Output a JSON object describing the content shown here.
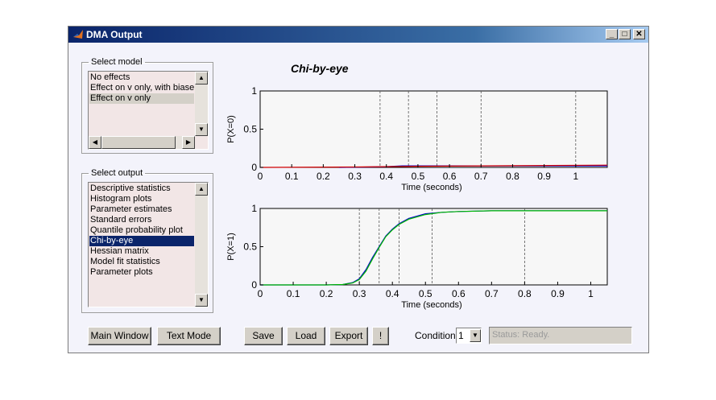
{
  "window": {
    "title": "DMA Output"
  },
  "select_model": {
    "legend": "Select model",
    "items": [
      "No effects",
      "Effect on v only, with biase",
      "Effect on v only"
    ],
    "selected_index": 2
  },
  "select_output": {
    "legend": "Select output",
    "items": [
      "Descriptive statistics",
      "Histogram plots",
      "Parameter estimates",
      "Standard errors",
      "Quantile probability plot",
      "Chi-by-eye",
      "Hessian matrix",
      "Model fit statistics",
      "Parameter plots"
    ],
    "selected_index": 5
  },
  "plot_title": "Chi-by-eye",
  "buttons": {
    "main_window": "Main Window",
    "text_mode": "Text Mode",
    "save": "Save",
    "load": "Load",
    "export": "Export",
    "bang": "!"
  },
  "condition": {
    "label": "Condition:",
    "value": "1"
  },
  "status": "Status: Ready.",
  "chart_data": [
    {
      "type": "line",
      "ylabel": "P(X=0)",
      "xlabel": "Time (seconds)",
      "xlim": [
        0,
        1.1
      ],
      "ylim": [
        0,
        1
      ],
      "xticks": [
        "0",
        "0.1",
        "0.2",
        "0.3",
        "0.4",
        "0.5",
        "0.6",
        "0.7",
        "0.8",
        "0.9",
        "1"
      ],
      "yticks": [
        "0",
        "0.5",
        "1"
      ],
      "quantile_lines": [
        0.38,
        0.47,
        0.56,
        0.7,
        1.0
      ],
      "series": [
        {
          "color": "#0000cc",
          "x": [
            0.25,
            0.35,
            0.4,
            0.45,
            0.5,
            0.55,
            1.1
          ],
          "y": [
            0,
            0.005,
            0.01,
            0.02,
            0.02,
            0.02,
            0.02
          ]
        },
        {
          "color": "#d00000",
          "x": [
            0,
            0.3,
            0.5,
            1.1
          ],
          "y": [
            0,
            0.005,
            0.015,
            0.03
          ]
        }
      ]
    },
    {
      "type": "line",
      "ylabel": "P(X=1)",
      "xlabel": "Time (seconds)",
      "xlim": [
        0,
        1.05
      ],
      "ylim": [
        0,
        1
      ],
      "xticks": [
        "0",
        "0.1",
        "0.2",
        "0.3",
        "0.4",
        "0.5",
        "0.6",
        "0.7",
        "0.8",
        "0.9",
        "1"
      ],
      "yticks": [
        "0",
        "0.5",
        "1"
      ],
      "quantile_lines": [
        0.3,
        0.36,
        0.42,
        0.52,
        0.8
      ],
      "series": [
        {
          "color": "#0000cc",
          "x": [
            0,
            0.2,
            0.25,
            0.28,
            0.3,
            0.32,
            0.34,
            0.36,
            0.38,
            0.4,
            0.42,
            0.45,
            0.5,
            0.55,
            0.6,
            0.7,
            0.8,
            1.05
          ],
          "y": [
            0,
            0,
            0.005,
            0.03,
            0.08,
            0.2,
            0.36,
            0.5,
            0.64,
            0.73,
            0.8,
            0.87,
            0.93,
            0.95,
            0.96,
            0.97,
            0.97,
            0.97
          ]
        },
        {
          "color": "#00bb00",
          "x": [
            0,
            0.2,
            0.25,
            0.28,
            0.3,
            0.32,
            0.34,
            0.36,
            0.38,
            0.4,
            0.42,
            0.45,
            0.5,
            0.55,
            0.6,
            0.7,
            0.8,
            1.05
          ],
          "y": [
            0,
            0,
            0.005,
            0.025,
            0.07,
            0.18,
            0.34,
            0.49,
            0.63,
            0.72,
            0.79,
            0.86,
            0.92,
            0.95,
            0.96,
            0.97,
            0.97,
            0.97
          ]
        }
      ]
    }
  ]
}
